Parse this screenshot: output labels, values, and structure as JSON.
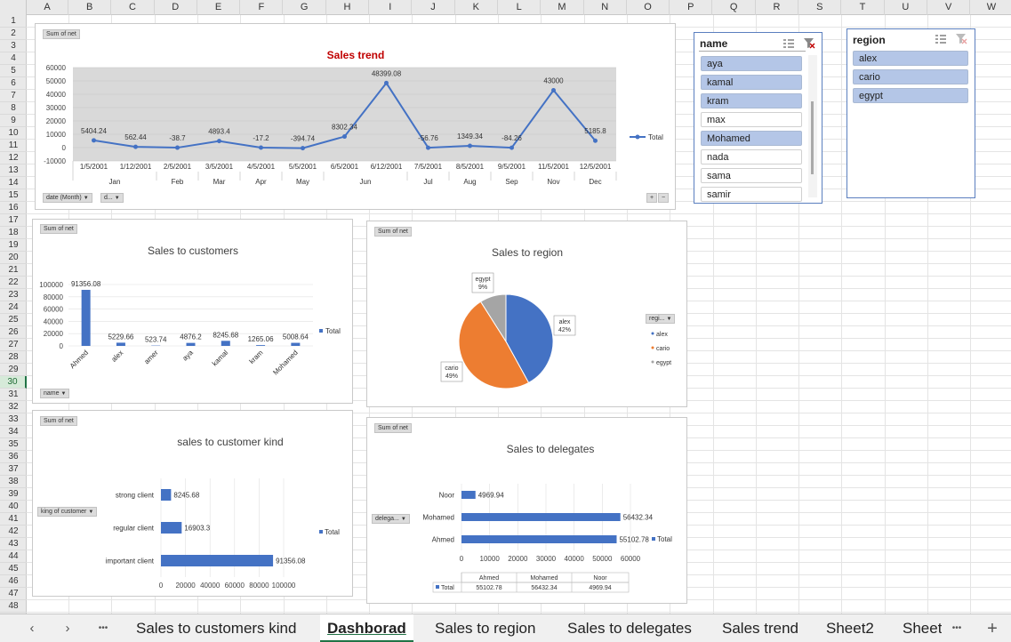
{
  "columns": [
    "A",
    "B",
    "C",
    "D",
    "E",
    "F",
    "G",
    "H",
    "I",
    "J",
    "K",
    "L",
    "M",
    "N",
    "O",
    "P",
    "Q",
    "R",
    "S",
    "T",
    "U",
    "V",
    "W"
  ],
  "rows": [
    "1",
    "2",
    "3",
    "4",
    "5",
    "6",
    "7",
    "8",
    "9",
    "10",
    "11",
    "12",
    "13",
    "14",
    "15",
    "16",
    "17",
    "18",
    "19",
    "20",
    "21",
    "22",
    "23",
    "24",
    "25",
    "26",
    "27",
    "28",
    "29",
    "30",
    "31",
    "32",
    "33",
    "34",
    "35",
    "36",
    "37",
    "38",
    "39",
    "40",
    "41",
    "42",
    "43",
    "44",
    "45",
    "46",
    "47",
    "48"
  ],
  "selected_row": "30",
  "trend_chart": {
    "field_button": "Sum of net",
    "title": "Sales trend",
    "legend": "Total",
    "filter1": "date (Month)",
    "filter2": "d...",
    "expand_plus": "+",
    "expand_minus": "−",
    "y_ticks": [
      "60000",
      "50000",
      "40000",
      "30000",
      "20000",
      "10000",
      "0",
      "-10000"
    ],
    "points": [
      {
        "date": "1/5/2001",
        "value": 5404.24,
        "label": "5404.24"
      },
      {
        "date": "1/12/2001",
        "value": 562.44,
        "label": "562.44"
      },
      {
        "date": "2/5/2001",
        "value": -38.7,
        "label": "-38.7"
      },
      {
        "date": "3/5/2001",
        "value": 4893.4,
        "label": "4893.4"
      },
      {
        "date": "4/5/2001",
        "value": -17.2,
        "label": "-17.2"
      },
      {
        "date": "5/5/2001",
        "value": -394.74,
        "label": "-394.74"
      },
      {
        "date": "6/5/2001",
        "value": 8302.34,
        "label": "8302.34"
      },
      {
        "date": "6/12/2001",
        "value": 48399.08,
        "label": "48399.08"
      },
      {
        "date": "7/5/2001",
        "value": -56.76,
        "label": "-56.76"
      },
      {
        "date": "8/5/2001",
        "value": 1349.34,
        "label": "1349.34"
      },
      {
        "date": "9/5/2001",
        "value": -84.26,
        "label": "-84.26"
      },
      {
        "date": "11/5/2001",
        "value": 43000,
        "label": "43000"
      },
      {
        "date": "12/5/2001",
        "value": 5185.8,
        "label": "5185.8"
      }
    ],
    "months": [
      "Jan",
      "Feb",
      "Mar",
      "Apr",
      "May",
      "Jun",
      "Jul",
      "Aug",
      "Sep",
      "Nov",
      "Dec"
    ]
  },
  "customers_chart": {
    "field_button": "Sum of net",
    "title": "Sales to customers",
    "legend": "Total",
    "filter": "name",
    "y_ticks": [
      "100000",
      "80000",
      "60000",
      "40000",
      "20000",
      "0"
    ],
    "bars": [
      {
        "name": "Ahmed",
        "value": 91356.08,
        "label": "91356.08"
      },
      {
        "name": "alex",
        "value": 5229.66,
        "label": "5229.66"
      },
      {
        "name": "amer",
        "value": 523.74,
        "label": "523.74"
      },
      {
        "name": "aya",
        "value": 4876.2,
        "label": "4876.2"
      },
      {
        "name": "kamal",
        "value": 8245.68,
        "label": "8245.68"
      },
      {
        "name": "kram",
        "value": 1265.06,
        "label": "1265.06"
      },
      {
        "name": "Mohamed",
        "value": 5008.64,
        "label": "5008.64"
      }
    ]
  },
  "region_chart": {
    "field_button": "Sum of net",
    "title": "Sales to region",
    "legend_filter": "regi...",
    "slices": [
      {
        "name": "alex",
        "pct": 42,
        "label": "alex",
        "pct_label": "42%",
        "color": "#4472c4"
      },
      {
        "name": "cario",
        "pct": 49,
        "label": "cario",
        "pct_label": "49%",
        "color": "#ed7d31"
      },
      {
        "name": "egypt",
        "pct": 9,
        "label": "egypt",
        "pct_label": "9%",
        "color": "#a5a5a5"
      }
    ]
  },
  "kind_chart": {
    "field_button": "Sum of net",
    "title": "sales to customer kind",
    "legend": "Total",
    "filter": "king of customer",
    "x_ticks": [
      "0",
      "20000",
      "40000",
      "60000",
      "80000",
      "100000"
    ],
    "bars": [
      {
        "name": "strong client",
        "value": 8245.68,
        "label": "8245.68"
      },
      {
        "name": "regular client",
        "value": 16903.3,
        "label": "16903.3"
      },
      {
        "name": "important client",
        "value": 91356.08,
        "label": "91356.08"
      }
    ]
  },
  "delegates_chart": {
    "field_button": "Sum of net",
    "title": "Sales to delegates",
    "legend": "Total",
    "filter": "delega...",
    "x_ticks": [
      "0",
      "10000",
      "20000",
      "30000",
      "40000",
      "50000",
      "60000"
    ],
    "bars": [
      {
        "name": "Noor",
        "value": 4969.94,
        "label": "4969.94"
      },
      {
        "name": "Mohamed",
        "value": 56432.34,
        "label": "56432.34"
      },
      {
        "name": "Ahmed",
        "value": 55102.78,
        "label": "55102.78"
      }
    ],
    "table_headers": [
      "Ahmed",
      "Mohamed",
      "Noor"
    ],
    "table_row_label": "Total",
    "table_values": [
      "55102.78",
      "56432.34",
      "4969.94"
    ]
  },
  "name_slicer": {
    "header": "name",
    "items": [
      {
        "label": "aya",
        "selected": true
      },
      {
        "label": "kamal",
        "selected": true
      },
      {
        "label": "kram",
        "selected": true
      },
      {
        "label": "max",
        "selected": false
      },
      {
        "label": "Mohamed",
        "selected": true
      },
      {
        "label": "nada",
        "selected": false
      },
      {
        "label": "sama",
        "selected": false
      },
      {
        "label": "samir",
        "selected": false
      }
    ]
  },
  "region_slicer": {
    "header": "region",
    "items": [
      {
        "label": "alex",
        "selected": true
      },
      {
        "label": "cario",
        "selected": true
      },
      {
        "label": "egypt",
        "selected": true
      }
    ]
  },
  "tabs": {
    "dots": "•••",
    "items": [
      "Sales to customers kind",
      "Dashborad",
      "Sales to region",
      "Sales to delegates",
      "Sales trend",
      "Sheet2",
      "Sheet"
    ],
    "active": "Dashborad",
    "more": "•••",
    "add": "+"
  },
  "chart_data": [
    {
      "type": "line",
      "title": "Sales trend",
      "x": [
        "1/5/2001",
        "1/12/2001",
        "2/5/2001",
        "3/5/2001",
        "4/5/2001",
        "5/5/2001",
        "6/5/2001",
        "6/12/2001",
        "7/5/2001",
        "8/5/2001",
        "9/5/2001",
        "11/5/2001",
        "12/5/2001"
      ],
      "series": [
        {
          "name": "Total",
          "values": [
            5404.24,
            562.44,
            -38.7,
            4893.4,
            -17.2,
            -394.74,
            8302.34,
            48399.08,
            -56.76,
            1349.34,
            -84.26,
            43000,
            5185.8
          ]
        }
      ],
      "ylim": [
        -10000,
        60000
      ],
      "legend": "right"
    },
    {
      "type": "bar",
      "title": "Sales to customers",
      "categories": [
        "Ahmed",
        "alex",
        "amer",
        "aya",
        "kamal",
        "kram",
        "Mohamed"
      ],
      "series": [
        {
          "name": "Total",
          "values": [
            91356.08,
            5229.66,
            523.74,
            4876.2,
            8245.68,
            1265.06,
            5008.64
          ]
        }
      ],
      "ylim": [
        0,
        100000
      ],
      "legend": "right"
    },
    {
      "type": "pie",
      "title": "Sales to region",
      "categories": [
        "alex",
        "cario",
        "egypt"
      ],
      "values": [
        42,
        49,
        9
      ],
      "legend": "right"
    },
    {
      "type": "bar",
      "title": "sales to customer kind",
      "categories": [
        "strong client",
        "regular client",
        "important client"
      ],
      "series": [
        {
          "name": "Total",
          "values": [
            8245.68,
            16903.3,
            91356.08
          ]
        }
      ],
      "xlim": [
        0,
        100000
      ],
      "legend": "right"
    },
    {
      "type": "bar",
      "title": "Sales to delegates",
      "categories": [
        "Noor",
        "Mohamed",
        "Ahmed"
      ],
      "series": [
        {
          "name": "Total",
          "values": [
            4969.94,
            56432.34,
            55102.78
          ]
        }
      ],
      "xlim": [
        0,
        60000
      ],
      "legend": "right"
    }
  ]
}
